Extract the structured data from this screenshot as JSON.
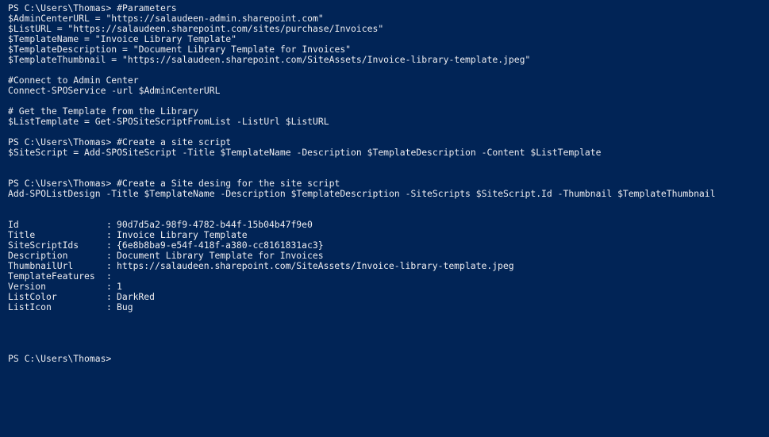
{
  "console": {
    "block_params": [
      "PS C:\\Users\\Thomas> #Parameters",
      "$AdminCenterURL = \"https://salaudeen-admin.sharepoint.com\"",
      "$ListURL = \"https://salaudeen.sharepoint.com/sites/purchase/Invoices\"",
      "$TemplateName = \"Invoice Library Template\"",
      "$TemplateDescription = \"Document Library Template for Invoices\"",
      "$TemplateThumbnail = \"https://salaudeen.sharepoint.com/SiteAssets/Invoice-library-template.jpeg\""
    ],
    "block_connect": [
      "#Connect to Admin Center",
      "Connect-SPOService -url $AdminCenterURL"
    ],
    "block_get": [
      "# Get the Template from the Library",
      "$ListTemplate = Get-SPOSiteScriptFromList -ListUrl $ListURL"
    ],
    "block_script": [
      "PS C:\\Users\\Thomas> #Create a site script",
      "$SiteScript = Add-SPOSiteScript -Title $TemplateName -Description $TemplateDescription -Content $ListTemplate"
    ],
    "block_design": [
      "PS C:\\Users\\Thomas> #Create a Site desing for the site script",
      "Add-SPOListDesign -Title $TemplateName -Description $TemplateDescription -SiteScripts $SiteScript.Id -Thumbnail $TemplateThumbnail"
    ],
    "separator": ":",
    "output": [
      {
        "name": "Id",
        "value": "90d7d5a2-98f9-4782-b44f-15b04b47f9e0"
      },
      {
        "name": "Title",
        "value": "Invoice Library Template"
      },
      {
        "name": "SiteScriptIds",
        "value": "{6e8b8ba9-e54f-418f-a380-cc8161831ac3}"
      },
      {
        "name": "Description",
        "value": "Document Library Template for Invoices"
      },
      {
        "name": "ThumbnailUrl",
        "value": "https://salaudeen.sharepoint.com/SiteAssets/Invoice-library-template.jpeg"
      },
      {
        "name": "TemplateFeatures",
        "value": ""
      },
      {
        "name": "Version",
        "value": "1"
      },
      {
        "name": "ListColor",
        "value": "DarkRed"
      },
      {
        "name": "ListIcon",
        "value": "Bug"
      }
    ],
    "final_prompt": "PS C:\\Users\\Thomas>"
  },
  "colors": {
    "background": "#012456",
    "foreground": "#eeedf0"
  }
}
